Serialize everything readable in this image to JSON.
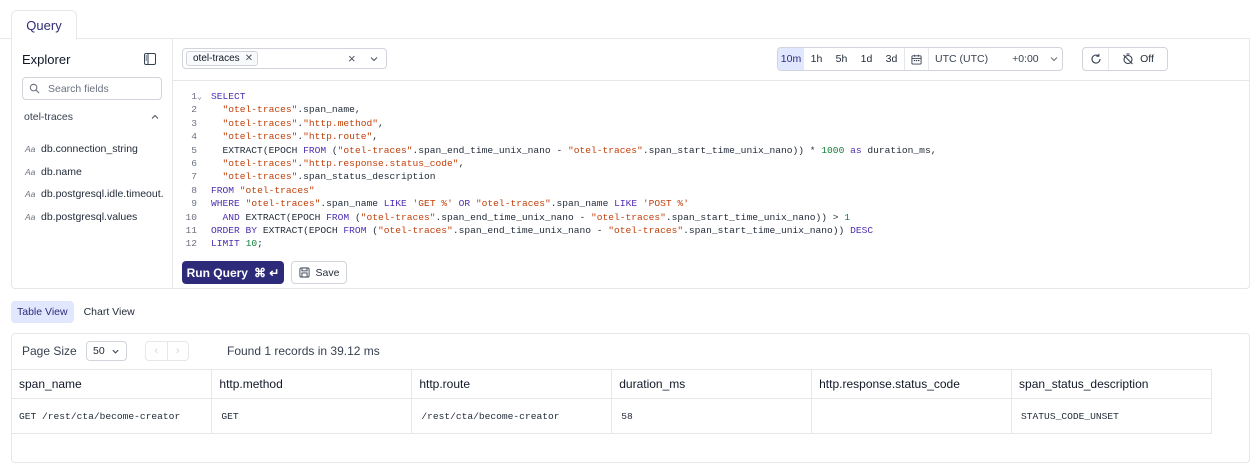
{
  "tabs": {
    "query": "Query"
  },
  "explorer": {
    "title": "Explorer",
    "search_placeholder": "Search fields",
    "source": "otel-traces",
    "field_type_glyph": "Aa",
    "fields": [
      "db.connection_string",
      "db.name",
      "db.postgresql.idle.timeout.",
      "db.postgresql.values"
    ]
  },
  "toolbar": {
    "selected_source": "otel-traces",
    "ranges": [
      "10m",
      "1h",
      "5h",
      "1d",
      "3d"
    ],
    "active_range": "10m",
    "timezone": "UTC (UTC)",
    "tz_offset": "+0:00",
    "auto_refresh": "Off"
  },
  "editor": {
    "lines": [
      {
        "n": "1",
        "fold": true,
        "tokens": [
          [
            "kw",
            "SELECT"
          ]
        ]
      },
      {
        "n": "2",
        "tokens": [
          [
            "plain",
            "  "
          ],
          [
            "str",
            "\"otel-traces\""
          ],
          [
            "plain",
            ".span_name,"
          ]
        ]
      },
      {
        "n": "3",
        "tokens": [
          [
            "plain",
            "  "
          ],
          [
            "str",
            "\"otel-traces\""
          ],
          [
            "plain",
            "."
          ],
          [
            "str",
            "\"http.method\""
          ],
          [
            "plain",
            ","
          ]
        ]
      },
      {
        "n": "4",
        "tokens": [
          [
            "plain",
            "  "
          ],
          [
            "str",
            "\"otel-traces\""
          ],
          [
            "plain",
            "."
          ],
          [
            "str",
            "\"http.route\""
          ],
          [
            "plain",
            ","
          ]
        ]
      },
      {
        "n": "5",
        "tokens": [
          [
            "plain",
            "  EXTRACT(EPOCH "
          ],
          [
            "kw",
            "FROM"
          ],
          [
            "plain",
            " ("
          ],
          [
            "str",
            "\"otel-traces\""
          ],
          [
            "plain",
            ".span_end_time_unix_nano - "
          ],
          [
            "str",
            "\"otel-traces\""
          ],
          [
            "plain",
            ".span_start_time_unix_nano)) * "
          ],
          [
            "num",
            "1000"
          ],
          [
            "plain",
            " "
          ],
          [
            "kw",
            "as"
          ],
          [
            "plain",
            " duration_ms,"
          ]
        ]
      },
      {
        "n": "6",
        "tokens": [
          [
            "plain",
            "  "
          ],
          [
            "str",
            "\"otel-traces\""
          ],
          [
            "plain",
            "."
          ],
          [
            "str",
            "\"http.response.status_code\""
          ],
          [
            "plain",
            ","
          ]
        ]
      },
      {
        "n": "7",
        "tokens": [
          [
            "plain",
            "  "
          ],
          [
            "str",
            "\"otel-traces\""
          ],
          [
            "plain",
            ".span_status_description"
          ]
        ]
      },
      {
        "n": "8",
        "tokens": [
          [
            "kw",
            "FROM"
          ],
          [
            "plain",
            " "
          ],
          [
            "str",
            "\"otel-traces\""
          ]
        ]
      },
      {
        "n": "9",
        "tokens": [
          [
            "kw",
            "WHERE"
          ],
          [
            "plain",
            " "
          ],
          [
            "str",
            "\"otel-traces\""
          ],
          [
            "plain",
            ".span_name "
          ],
          [
            "kw",
            "LIKE"
          ],
          [
            "plain",
            " "
          ],
          [
            "str",
            "'GET %'"
          ],
          [
            "plain",
            " "
          ],
          [
            "kw",
            "OR"
          ],
          [
            "plain",
            " "
          ],
          [
            "str",
            "\"otel-traces\""
          ],
          [
            "plain",
            ".span_name "
          ],
          [
            "kw",
            "LIKE"
          ],
          [
            "plain",
            " "
          ],
          [
            "str",
            "'POST %'"
          ]
        ]
      },
      {
        "n": "10",
        "tokens": [
          [
            "plain",
            "  "
          ],
          [
            "kw",
            "AND"
          ],
          [
            "plain",
            " EXTRACT(EPOCH "
          ],
          [
            "kw",
            "FROM"
          ],
          [
            "plain",
            " ("
          ],
          [
            "str",
            "\"otel-traces\""
          ],
          [
            "plain",
            ".span_end_time_unix_nano - "
          ],
          [
            "str",
            "\"otel-traces\""
          ],
          [
            "plain",
            ".span_start_time_unix_nano)) > "
          ],
          [
            "num",
            "1"
          ]
        ]
      },
      {
        "n": "11",
        "tokens": [
          [
            "kw",
            "ORDER BY"
          ],
          [
            "plain",
            " EXTRACT(EPOCH "
          ],
          [
            "kw",
            "FROM"
          ],
          [
            "plain",
            " ("
          ],
          [
            "str",
            "\"otel-traces\""
          ],
          [
            "plain",
            ".span_end_time_unix_nano - "
          ],
          [
            "str",
            "\"otel-traces\""
          ],
          [
            "plain",
            ".span_start_time_unix_nano)) "
          ],
          [
            "kw",
            "DESC"
          ]
        ]
      },
      {
        "n": "12",
        "tokens": [
          [
            "kw",
            "LIMIT"
          ],
          [
            "plain",
            " "
          ],
          [
            "num",
            "10"
          ],
          [
            "plain",
            ";"
          ]
        ]
      }
    ]
  },
  "actions": {
    "run": "Run Query",
    "run_shortcut": "⌘ ↵",
    "save": "Save"
  },
  "views": {
    "table": "Table View",
    "chart": "Chart View"
  },
  "results": {
    "page_size_label": "Page Size",
    "page_size": "50",
    "found": "Found 1 records in 39.12 ms",
    "columns": [
      "span_name",
      "http.method",
      "http.route",
      "duration_ms",
      "http.response.status_code",
      "span_status_description"
    ],
    "rows": [
      [
        "GET /rest/cta/become-creator",
        "GET",
        "/rest/cta/become-creator",
        "58",
        "",
        "STATUS_CODE_UNSET"
      ]
    ]
  }
}
